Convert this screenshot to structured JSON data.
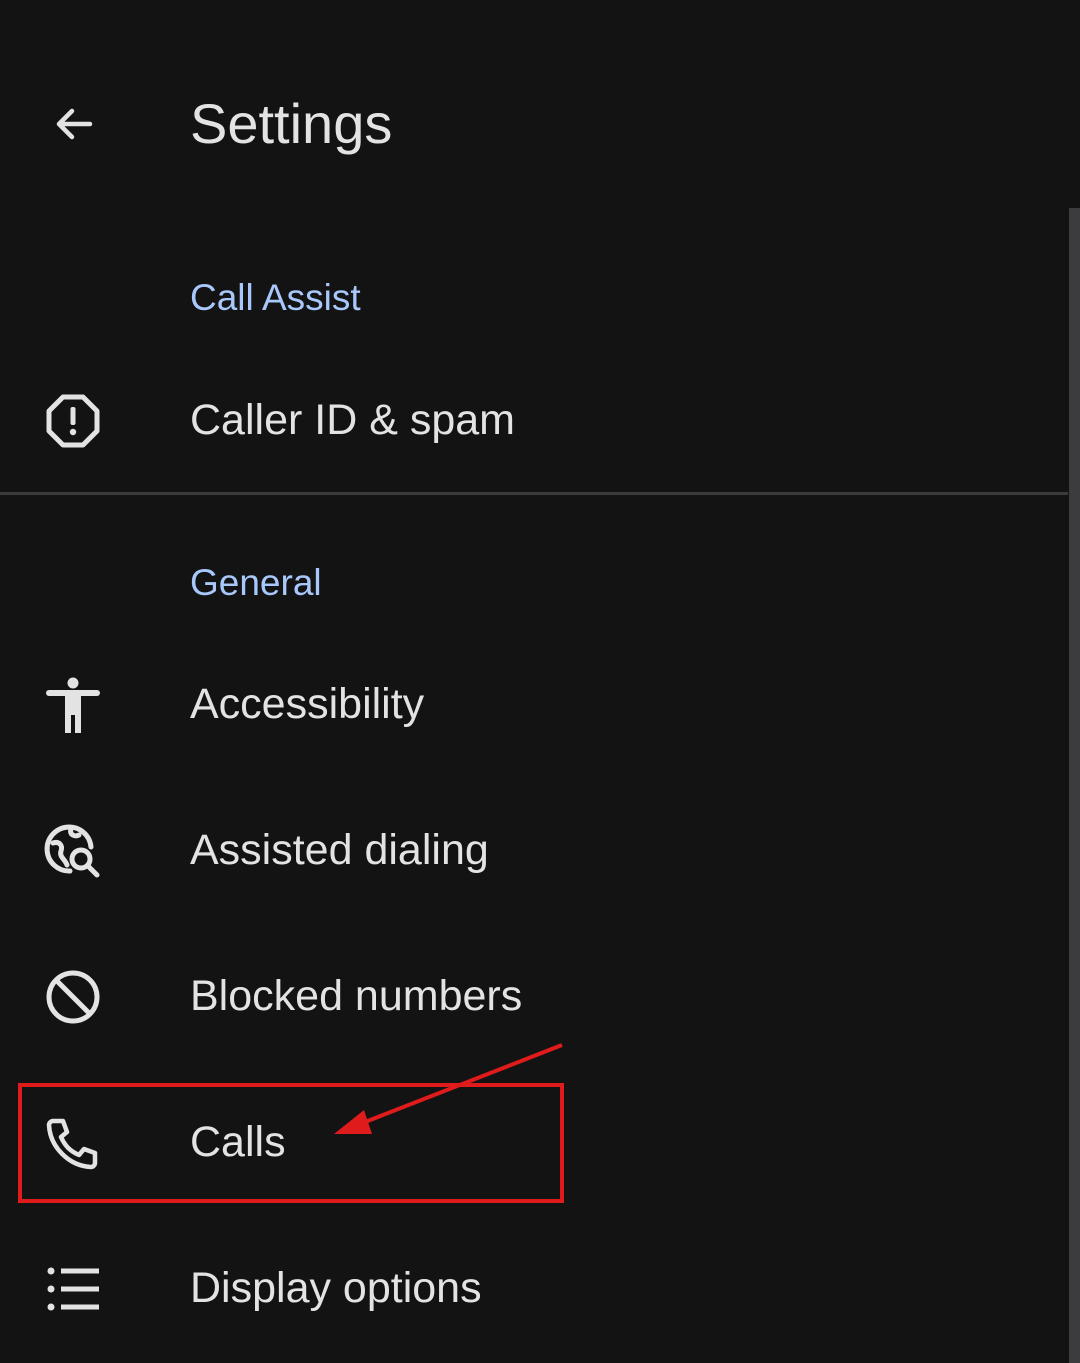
{
  "app_bar": {
    "title": "Settings",
    "back_icon": "arrow-back-icon"
  },
  "sections": [
    {
      "header": "Call Assist",
      "items": [
        {
          "label": "Caller ID & spam",
          "icon": "spam-octagon-icon"
        }
      ]
    },
    {
      "header": "General",
      "items": [
        {
          "label": "Accessibility",
          "icon": "accessibility-icon"
        },
        {
          "label": "Assisted dialing",
          "icon": "globe-search-icon"
        },
        {
          "label": "Blocked numbers",
          "icon": "block-icon"
        },
        {
          "label": "Calls",
          "icon": "phone-icon"
        },
        {
          "label": "Display options",
          "icon": "list-icon"
        }
      ]
    }
  ],
  "colors": {
    "background": "#131314",
    "text": "#e3e3e3",
    "section_header": "#a8c7fa",
    "annotation": "#e01b1b"
  }
}
